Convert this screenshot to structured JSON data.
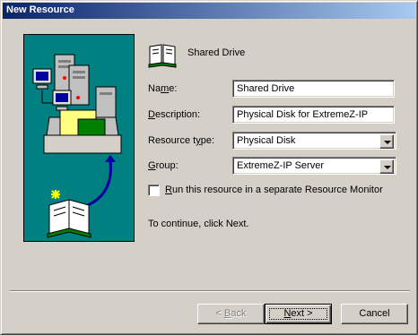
{
  "window": {
    "title": "New Resource"
  },
  "header": {
    "label": "Shared Drive",
    "icon": "open-book-icon"
  },
  "form": {
    "name": {
      "label_pre": "Na",
      "label_u": "m",
      "label_post": "e:",
      "value": "Shared Drive"
    },
    "description": {
      "label_pre": "",
      "label_u": "D",
      "label_post": "escription:",
      "value": "Physical Disk for ExtremeZ-IP"
    },
    "resource_type": {
      "label_pre": "Resource t",
      "label_u": "y",
      "label_post": "pe:",
      "value": "Physical Disk"
    },
    "group": {
      "label_pre": "",
      "label_u": "G",
      "label_post": "roup:",
      "value": "ExtremeZ-IP Server"
    },
    "separate_monitor": {
      "label_pre": "",
      "label_u": "R",
      "label_post": "un this resource in a separate Resource Monitor",
      "checked": false
    }
  },
  "instructions": "To continue, click Next.",
  "buttons": {
    "back": {
      "label_pre": "< ",
      "label_u": "B",
      "label_post": "ack",
      "enabled": false
    },
    "next": {
      "label_pre": "",
      "label_u": "N",
      "label_post": "ext >",
      "enabled": true
    },
    "cancel": {
      "label": "Cancel",
      "enabled": true
    }
  },
  "colors": {
    "title_start": "#0a246a",
    "title_end": "#a6caf0",
    "art_bg": "#008080",
    "face": "#d4d0c8"
  }
}
